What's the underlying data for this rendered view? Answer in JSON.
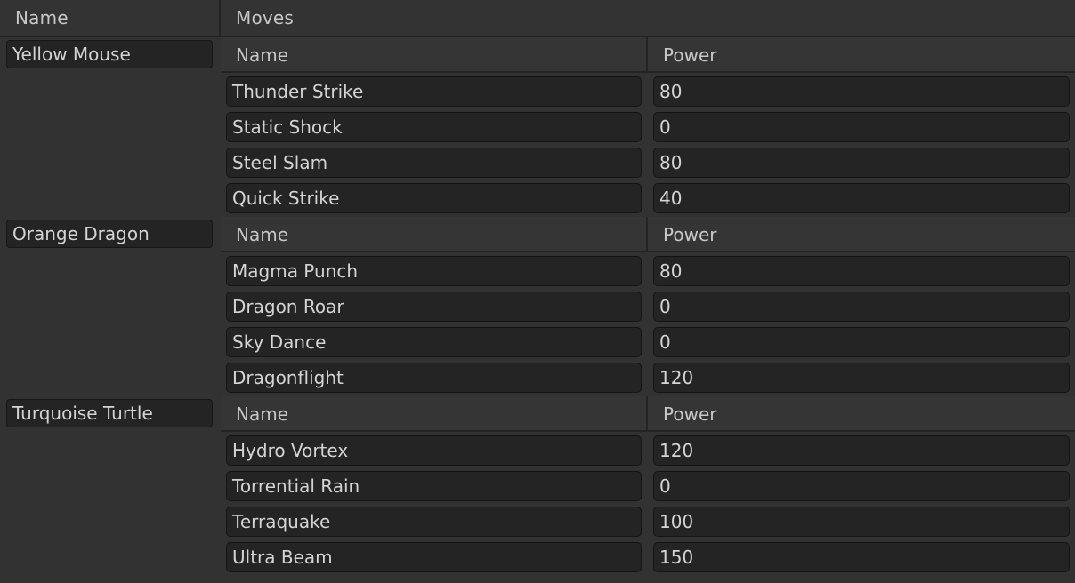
{
  "header": {
    "name_label": "Name",
    "moves_label": "Moves"
  },
  "moves_header": {
    "name_label": "Name",
    "power_label": "Power"
  },
  "creatures": [
    {
      "name": "Yellow Mouse",
      "moves": [
        {
          "name": "Thunder Strike",
          "power": "80"
        },
        {
          "name": "Static Shock",
          "power": "0"
        },
        {
          "name": "Steel Slam",
          "power": "80"
        },
        {
          "name": "Quick Strike",
          "power": "40"
        }
      ]
    },
    {
      "name": "Orange Dragon",
      "moves": [
        {
          "name": "Magma Punch",
          "power": "80"
        },
        {
          "name": "Dragon Roar",
          "power": "0"
        },
        {
          "name": "Sky Dance",
          "power": "0"
        },
        {
          "name": "Dragonflight",
          "power": "120"
        }
      ]
    },
    {
      "name": "Turquoise Turtle",
      "moves": [
        {
          "name": "Hydro Vortex",
          "power": "120"
        },
        {
          "name": "Torrential Rain",
          "power": "0"
        },
        {
          "name": "Terraquake",
          "power": "100"
        },
        {
          "name": "Ultra Beam",
          "power": "150"
        }
      ]
    }
  ]
}
